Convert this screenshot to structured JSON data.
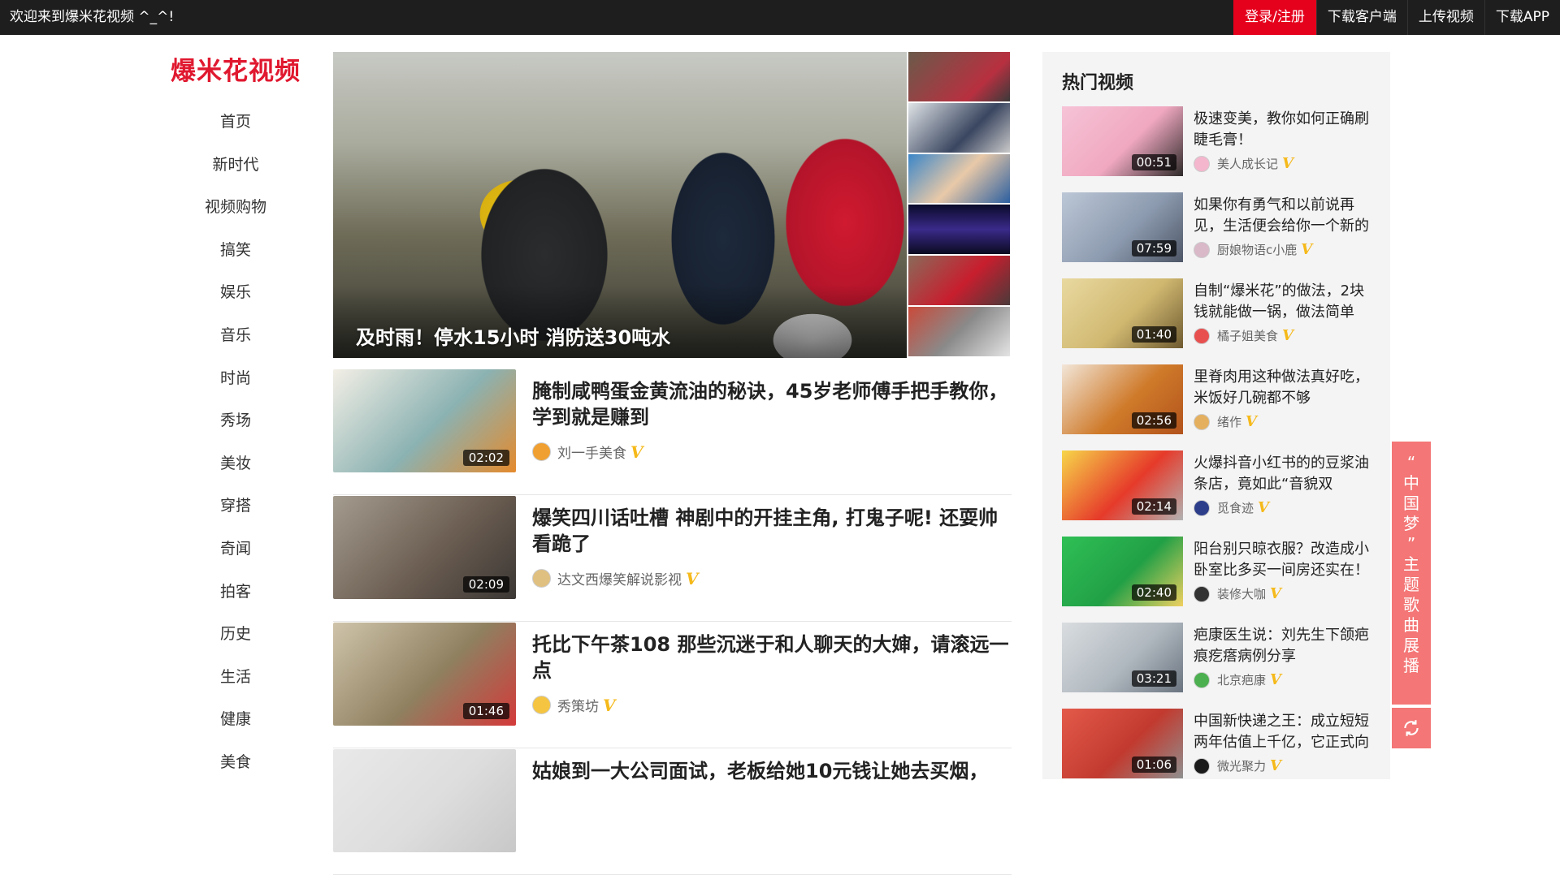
{
  "topbar": {
    "welcome": "欢迎来到爆米花视频 ^_^!",
    "links": [
      "登录/注册",
      "下载客户端",
      "上传视频",
      "下载APP"
    ]
  },
  "logo": "爆米花视频",
  "nav": [
    "首页",
    "新时代",
    "视频购物",
    "搞笑",
    "娱乐",
    "音乐",
    "时尚",
    "秀场",
    "美妆",
    "穿搭",
    "奇闻",
    "拍客",
    "历史",
    "生活",
    "健康",
    "美食"
  ],
  "hero": {
    "caption": "及时雨！停水15小时 消防送30吨水"
  },
  "feed": [
    {
      "title": "腌制咸鸭蛋金黄流油的秘诀，45岁老师傅手把手教你，学到就是赚到",
      "duration": "02:02",
      "author": "刘一手美食",
      "thumb": [
        "#f3efe6",
        "#8bb2b2",
        "#e58a2c"
      ]
    },
    {
      "title": "爆笑四川话吐槽 神剧中的开挂主角, 打鬼子呢! 还耍帅 看跪了",
      "duration": "02:09",
      "author": "达文西爆笑解说影视",
      "thumb": [
        "#a49c8f",
        "#6c5e52",
        "#3b3734"
      ]
    },
    {
      "title": "托比下午茶108 那些沉迷于和人聊天的大婶，请滚远一点",
      "duration": "01:46",
      "author": "秀策坊",
      "thumb": [
        "#cfc4aa",
        "#8f8060",
        "#d33a3a"
      ]
    },
    {
      "title": "姑娘到一大公司面试，老板给她10元钱让她去买烟，",
      "duration": "",
      "author": "",
      "thumb": [
        "#e9e9e9",
        "#dddddd",
        "#c8c8c8"
      ]
    }
  ],
  "hot": {
    "heading": "热门视频",
    "items": [
      {
        "title": "极速变美，教你如何正确刷睫毛膏！",
        "duration": "00:51",
        "author": "美人成长记",
        "thumb": [
          "#f6c3d6",
          "#f0a8c0",
          "#2e2a2a"
        ]
      },
      {
        "title": "如果你有勇气和以前说再见，生活便会给你一个新的",
        "duration": "07:59",
        "author": "厨娘物语c小鹿",
        "thumb": [
          "#bcc7d6",
          "#8d9bb0",
          "#4d5666"
        ]
      },
      {
        "title": "自制“爆米花”的做法，2块钱就能做一锅，做法简单",
        "duration": "01:40",
        "author": "橘子姐美食",
        "thumb": [
          "#e9d9a0",
          "#d0b870",
          "#6e5a30"
        ]
      },
      {
        "title": "里脊肉用这种做法真好吃，米饭好几碗都不够",
        "duration": "02:56",
        "author": "绪作",
        "thumb": [
          "#f2e6d8",
          "#cf7a2a",
          "#b2531c"
        ]
      },
      {
        "title": "火爆抖音小红书的的豆浆油条店，竟如此“音貌双",
        "duration": "02:14",
        "author": "觅食迹",
        "thumb": [
          "#f7d64a",
          "#e63a2a",
          "#b2b2b2"
        ]
      },
      {
        "title": "阳台别只晾衣服？改造成小卧室比多买一间房还实在！",
        "duration": "02:40",
        "author": "装修大咖",
        "thumb": [
          "#2fbf55",
          "#21a046",
          "#f0d060"
        ]
      },
      {
        "title": "疤康医生说：刘先生下颌疤痕疙瘩病例分享",
        "duration": "03:21",
        "author": "北京疤康",
        "thumb": [
          "#d9dde0",
          "#b0b8bf",
          "#6a7480"
        ]
      },
      {
        "title": "中国新快递之王：成立短短两年估值上千亿，它正式向",
        "duration": "01:06",
        "author": "微光聚力",
        "thumb": [
          "#e35a4a",
          "#c23a2f",
          "#8f8f8f"
        ]
      }
    ]
  },
  "float_banner": {
    "text": "“中国梦”主题歌曲展播",
    "chars": [
      "“",
      "中",
      "国",
      "梦",
      "”",
      "主",
      "题",
      "歌",
      "曲",
      "展",
      "播"
    ]
  },
  "colors": {
    "accent_red": "#e5001c",
    "logo_red": "#e0182f",
    "verified_gold": "#f5b91a",
    "banner_pink": "#f47676"
  }
}
